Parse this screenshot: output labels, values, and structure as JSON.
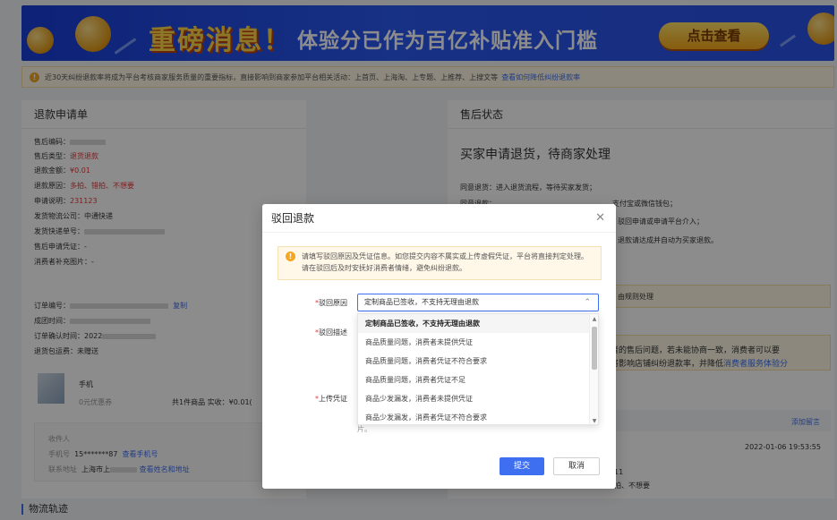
{
  "banner": {
    "headline": "重磅消息！",
    "subline": "体验分已作为百亿补贴准入门槛",
    "cta": "点击查看"
  },
  "notice": {
    "icon": "warning-icon",
    "text": "近30天纠纷退款率将成为平台考核商家服务质量的重要指标，直接影响到商家参加平台相关活动：上首页、上海淘、上专题、上推荐、上搜文等",
    "link": "查看如何降低纠纷退款率"
  },
  "refund": {
    "title": "退款申请单",
    "sn_label": "售后编码：",
    "type_label": "售后类型：",
    "type_value": "退货退款",
    "amount_label": "退款金额：",
    "amount_value": "¥0.01",
    "reason_label": "退款原因：",
    "reason_value": "多拍、错拍、不想要",
    "desc_label": "申请说明：",
    "desc_value": "231123",
    "company_label": "发货物流公司：",
    "company_value": "中通快递",
    "tracking_label": "发货快递单号：",
    "evidence_label": "售后申请凭证：",
    "evidence_value": "-",
    "buyer_images_label": "消费者补充图片：",
    "buyer_images_value": "-",
    "order_label": "订单编号：",
    "copy_label": "复制",
    "deal_time_label": "成团时间：",
    "confirm_time_label": "订单确认时间：",
    "confirm_time_value": "2022",
    "ship_label": "退货包运费：",
    "ship_value": "未赠送",
    "product_name": "手机",
    "coupon": "0元优惠券",
    "total": "共1件商品  实收：¥0.01(",
    "receiver_label": "收件人",
    "phone_label": "手机号",
    "phone_value": "15*******87",
    "phone_link": "查看手机号",
    "addr_label": "联系地址",
    "addr_value": "上海市上",
    "addr_link": "查看姓名和地址",
    "logistics_title": "物流轨迹"
  },
  "after_sale": {
    "title": "售后状态",
    "status": "买家申请退货，待商家处理",
    "line1": "同意退货：进入退货流程，等待买家发货；",
    "line2_head": "同意退款：",
    "line2_tail": "支付宝或微信钱包；",
    "line3": "驳回申请或申请平台介入；",
    "line4": "退款请达成并自动为买家退款。",
    "rule_text": "由规则处理",
    "warn_line1": "者的售后问题，若未能协商一致，消费者可以要",
    "warn_line2_a": "将影响店铺纠纷退款率，并降低",
    "warn_line2_b": "消费者服务体验分",
    "add_msg": "添加留言",
    "msg_time": "2022-01-06 19:53:55",
    "msg_frag1": "11",
    "msg_frag2": "拍、不想要"
  },
  "modal": {
    "title": "驳回退款",
    "tip": "请填写驳回原因及凭证信息。如您提交内容不属实或上传虚假凭证，平台将直接判定处理。请在驳回后及时安抚好消费者情绪，避免纠纷退款。",
    "reason_label": "驳回原因",
    "desc_label": "驳回描述",
    "upload_label": "上传凭证",
    "selected": "定制商品已签收，不支持无理由退款",
    "options": [
      "定制商品已签收，不支持无理由退款",
      "商品质量问题，消费者未提供凭证",
      "商品质量问题，消费者凭证不符合要求",
      "商品质量问题，消费者凭证不足",
      "商品少发漏发，消费者未提供凭证",
      "商品少发漏发，消费者凭证不符合要求"
    ],
    "behind_fragment": "片。",
    "submit": "提交",
    "cancel": "取消"
  },
  "colors": {
    "primary": "#3d6ff0",
    "danger": "#e4393c",
    "warning": "#f5a623"
  }
}
